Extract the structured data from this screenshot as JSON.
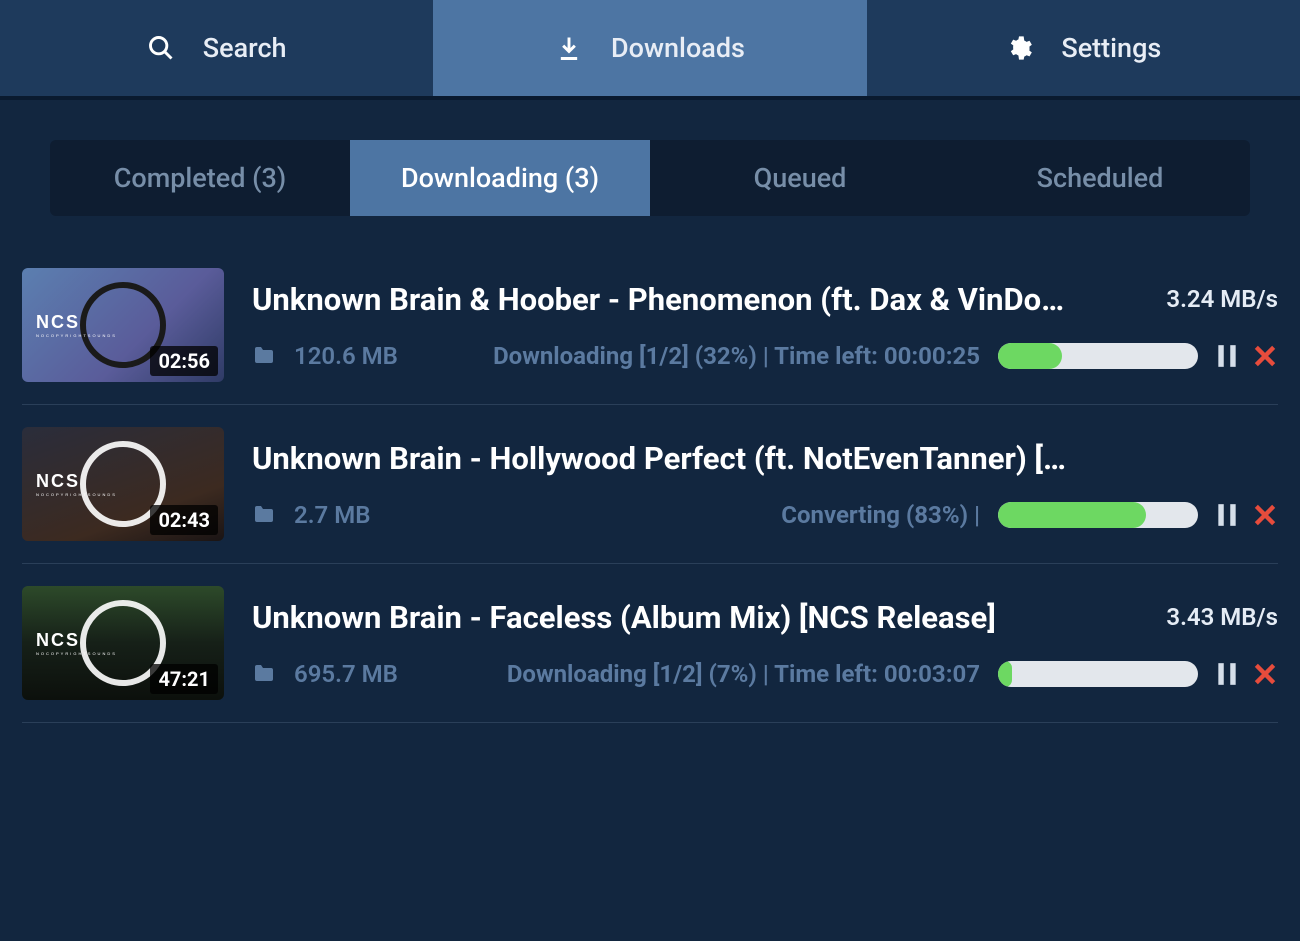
{
  "nav": {
    "search": "Search",
    "downloads": "Downloads",
    "settings": "Settings"
  },
  "tabs": {
    "completed": "Completed (3)",
    "downloading": "Downloading (3)",
    "queued": "Queued",
    "scheduled": "Scheduled"
  },
  "items": [
    {
      "title": "Unknown Brain & Hoober - Phenomenon (ft. Dax & VinDo…",
      "duration": "02:56",
      "speed": "3.24 MB/s",
      "size": "120.6 MB",
      "status": "Downloading [1/2] (32%)   |   Time left: 00:00:25",
      "progress": 32
    },
    {
      "title": "Unknown Brain - Hollywood Perfect (ft. NotEvenTanner) […",
      "duration": "02:43",
      "speed": "",
      "size": "2.7 MB",
      "status": "Converting (83%)   |",
      "progress": 74
    },
    {
      "title": "Unknown Brain - Faceless (Album Mix) [NCS Release]",
      "duration": "47:21",
      "speed": "3.43 MB/s",
      "size": "695.7 MB",
      "status": "Downloading [1/2] (7%)   |   Time left: 00:03:07",
      "progress": 7
    }
  ]
}
